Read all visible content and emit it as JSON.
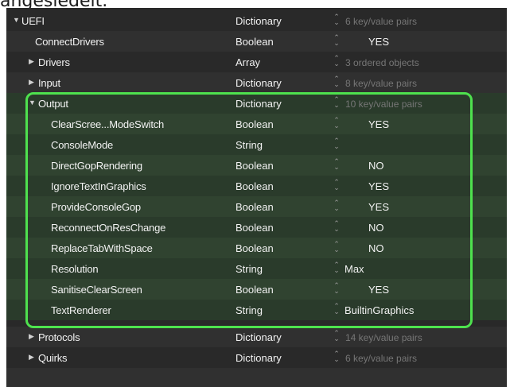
{
  "caption": "angesiedelt.",
  "rows": [
    {
      "key": "UEFI",
      "expander": "▼",
      "type": "Dictionary",
      "value": "6 key/value pairs"
    },
    {
      "key": "ConnectDrivers",
      "expander": "",
      "type": "Boolean",
      "value": "YES"
    },
    {
      "key": "Drivers",
      "expander": "▶",
      "type": "Array",
      "value": "3 ordered objects"
    },
    {
      "key": "Input",
      "expander": "▶",
      "type": "Dictionary",
      "value": "8 key/value pairs"
    },
    {
      "key": "Output",
      "expander": "▼",
      "type": "Dictionary",
      "value": "10 key/value pairs"
    },
    {
      "key": "ClearScree...ModeSwitch",
      "expander": "",
      "type": "Boolean",
      "value": "YES"
    },
    {
      "key": "ConsoleMode",
      "expander": "",
      "type": "String",
      "value": ""
    },
    {
      "key": "DirectGopRendering",
      "expander": "",
      "type": "Boolean",
      "value": "NO"
    },
    {
      "key": "IgnoreTextInGraphics",
      "expander": "",
      "type": "Boolean",
      "value": "YES"
    },
    {
      "key": "ProvideConsoleGop",
      "expander": "",
      "type": "Boolean",
      "value": "YES"
    },
    {
      "key": "ReconnectOnResChange",
      "expander": "",
      "type": "Boolean",
      "value": "NO"
    },
    {
      "key": "ReplaceTabWithSpace",
      "expander": "",
      "type": "Boolean",
      "value": "NO"
    },
    {
      "key": "Resolution",
      "expander": "",
      "type": "String",
      "value": "Max"
    },
    {
      "key": "SanitiseClearScreen",
      "expander": "",
      "type": "Boolean",
      "value": "YES"
    },
    {
      "key": "TextRenderer",
      "expander": "",
      "type": "String",
      "value": "BuiltinGraphics"
    },
    {
      "key": "Protocols",
      "expander": "▶",
      "type": "Dictionary",
      "value": "14 key/value pairs"
    },
    {
      "key": "Quirks",
      "expander": "▶",
      "type": "Dictionary",
      "value": "6 key/value pairs"
    }
  ],
  "stepper_glyph": "⌃⌄",
  "colors": {
    "background": "#292929",
    "highlight_border": "#4ee14e",
    "text": "#f2f2f2",
    "dim_text": "#767676"
  }
}
